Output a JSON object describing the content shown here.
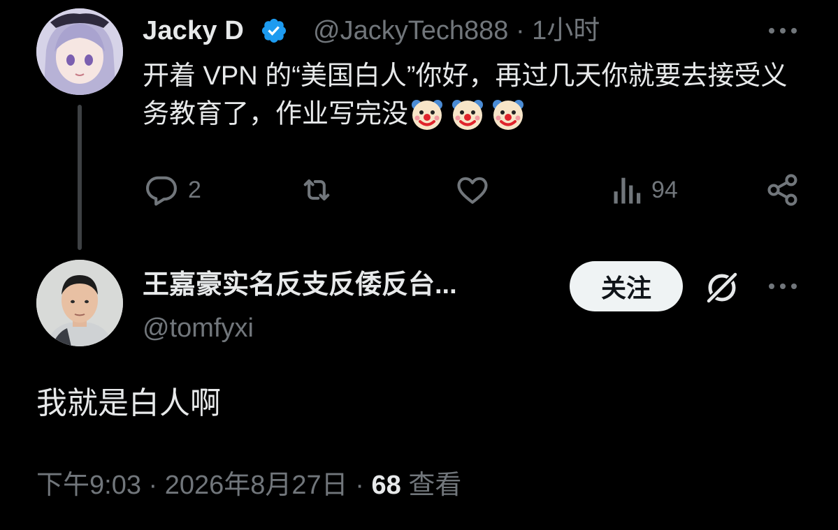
{
  "parent_tweet": {
    "author_name": "Jacky D",
    "handle": "@JackyTech888",
    "separator": "·",
    "time_ago": "1小时",
    "text_before_emoji": "开着 VPN 的“美国白人”你好，再过几天你就要去接受义务教育了，作业写完没",
    "emojis": [
      "clown-face",
      "clown-face",
      "clown-face"
    ],
    "actions": {
      "reply_count": "2",
      "repost_count": "",
      "like_count": "",
      "views_count": "94"
    }
  },
  "reply_tweet": {
    "author_name": "王嘉豪实名反支反倭反台...",
    "handle": "@tomfyxi",
    "follow_label": "关注",
    "text": "我就是白人啊",
    "timestamp": "下午9:03",
    "separator": "·",
    "date": "2026年8月27日",
    "separator2": "·",
    "views_count": "68",
    "views_label": "查看"
  },
  "colors": {
    "background": "#000000",
    "primary_text": "#e7e9ea",
    "secondary_text": "#71767b",
    "verified_badge": "#1d9bf0",
    "follow_button_bg": "#eff3f4"
  }
}
